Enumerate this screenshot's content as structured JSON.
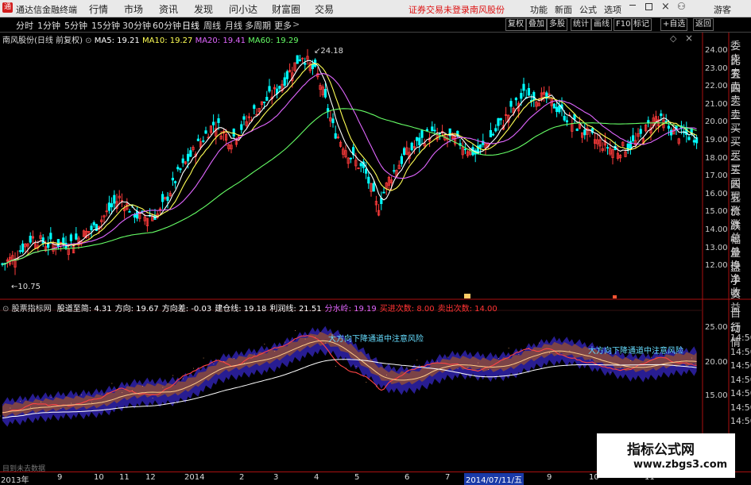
{
  "window": {
    "app_title": "通达信金融终端",
    "logo_glyph": "通"
  },
  "menu": [
    "行情",
    "市场",
    "资讯",
    "发现",
    "问小达",
    "财富圈",
    "交易"
  ],
  "status": {
    "login_warning": "证券交易未登录",
    "stock_name": "南风股份"
  },
  "right_menu": [
    "功能",
    "新面",
    "公式",
    "选项"
  ],
  "guest": "游客",
  "periods": [
    "分时",
    "1分钟",
    "5分钟",
    "15分钟",
    "30分钟",
    "60分钟",
    "日线",
    "周线",
    "月线",
    "多周期",
    "更多"
  ],
  "active_period": "日线",
  "toolbar": [
    "复权",
    "叠加",
    "多股",
    "统计",
    "画线",
    "F10",
    "标记",
    "+自选",
    "返回"
  ],
  "main": {
    "label": "南风股份(日线 前复权)",
    "ma": [
      {
        "name": "MA5",
        "value": "19.21"
      },
      {
        "name": "MA10",
        "value": "19.27"
      },
      {
        "name": "MA20",
        "value": "19.41"
      },
      {
        "name": "MA60",
        "value": "19.29"
      }
    ],
    "high_label": "24.18",
    "low_label": "10.75",
    "yaxis": [
      "24.00",
      "23.00",
      "22.00",
      "21.00",
      "20.00",
      "19.00",
      "18.00",
      "17.00",
      "16.00",
      "15.00",
      "14.00",
      "13.00",
      "12.00"
    ]
  },
  "right_panel": [
    "委比",
    "卖五",
    "卖四",
    "卖三",
    "卖二",
    "卖一",
    "买一",
    "买二",
    "买三",
    "买四",
    "买五",
    "现价",
    "涨跌",
    "涨幅",
    "总量",
    "外盘",
    "换手",
    "净资",
    "收益",
    "自动",
    "行情",
    "14:50",
    "14:50",
    "14:50",
    "14:50",
    "14:50",
    "14:50",
    "14:50"
  ],
  "sub": {
    "name": "股票指标网",
    "items": [
      {
        "label": "股道至简",
        "value": "4.31",
        "color": "#ffffff"
      },
      {
        "label": "方向",
        "value": "19.67",
        "color": "#ffffff"
      },
      {
        "label": "方向差",
        "value": "-0.03",
        "color": "#ffffff"
      },
      {
        "label": "建仓线",
        "value": "19.18",
        "color": "#ffffff"
      },
      {
        "label": "利润线",
        "value": "21.51",
        "color": "#ffffff"
      },
      {
        "label": "分水岭",
        "value": "19.19",
        "color": "#e066ff"
      },
      {
        "label": "买进次数",
        "value": "8.00",
        "color": "#ff3333"
      },
      {
        "label": "卖出次数",
        "value": "14.00",
        "color": "#ff3333"
      }
    ],
    "annotation_1": "大方向下降通道中注意风险",
    "annotation_2": "大方向下降通道中注意风险",
    "yaxis": [
      "25.00",
      "20.00",
      "15.00"
    ],
    "footer_text": "目到未去数据"
  },
  "dates": [
    "2013年",
    "9",
    "10",
    "11",
    "12",
    "2014",
    "2",
    "3",
    "4",
    "5",
    "6",
    "7",
    "2014/07/11/五",
    "9",
    "10",
    "11"
  ],
  "watermark": {
    "title": "指标公式网",
    "url": "www.zbgs3.com"
  },
  "colors": {
    "up": "#ff3b3b",
    "down": "#00ffff",
    "ma5": "#ffffff",
    "ma10": "#ffff55",
    "ma20": "#e066ff",
    "ma60": "#66ff66",
    "accent": "#d11111"
  }
}
